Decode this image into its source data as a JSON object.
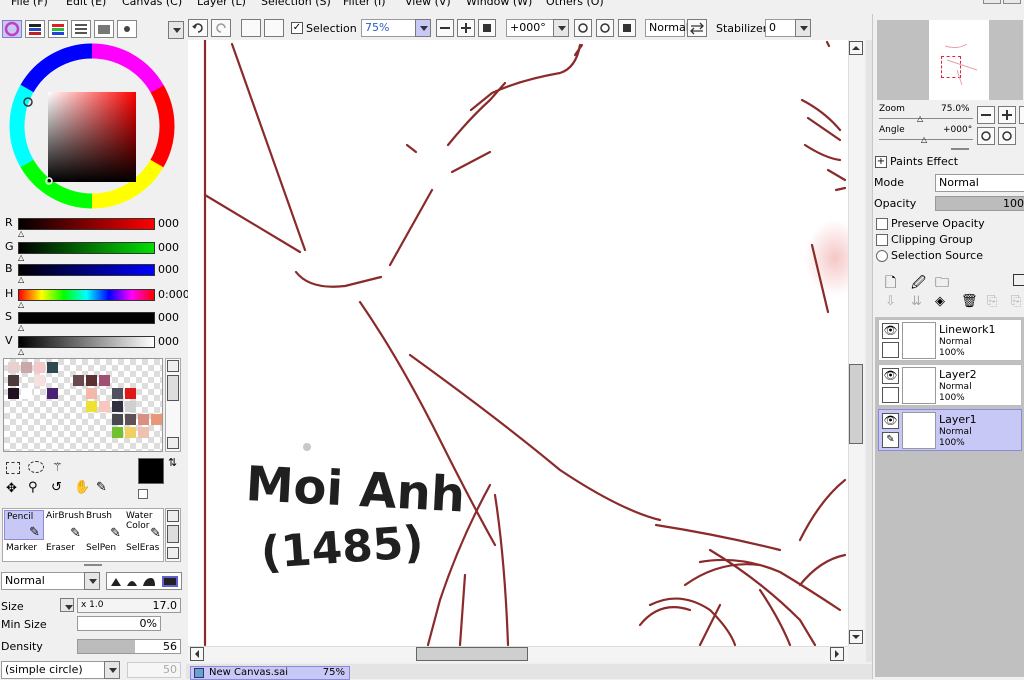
{
  "menu": [
    "File (F)",
    "Edit (E)",
    "Canvas (C)",
    "Layer (L)",
    "Selection (S)",
    "Filter (I)",
    "View (V)",
    "Window (W)",
    "Others (O)"
  ],
  "toolbar": {
    "selection_label": "Selection",
    "zoom_value": "75%",
    "angle_value": "+000°",
    "blend_mode": "Normal",
    "stabilizer_label": "Stabilizer",
    "stabilizer_value": "0"
  },
  "color": {
    "sliders": [
      {
        "label": "R",
        "value": "000"
      },
      {
        "label": "G",
        "value": "000"
      },
      {
        "label": "B",
        "value": "000"
      },
      {
        "label": "H",
        "value": "0:000"
      },
      {
        "label": "S",
        "value": "000"
      },
      {
        "label": "V",
        "value": "000"
      }
    ],
    "primary": "#000000",
    "secondary": "#ffffff"
  },
  "swatches": [
    {
      "c": "#e8d0d0",
      "r": 0,
      "col": 0
    },
    {
      "c": "#c8a8a8",
      "r": 0,
      "col": 1
    },
    {
      "c": "#f4c8c8",
      "r": 0,
      "col": 2
    },
    {
      "c": "#2e4a50",
      "r": 0,
      "col": 3
    },
    {
      "c": "#4a3a3a",
      "r": 1,
      "col": 0
    },
    {
      "c": "#f8e0e0",
      "r": 1,
      "col": 2
    },
    {
      "c": "#6a4850",
      "r": 1,
      "col": 5
    },
    {
      "c": "#5a3030",
      "r": 1,
      "col": 6
    },
    {
      "c": "#a05070",
      "r": 1,
      "col": 7
    },
    {
      "c": "#201020",
      "r": 2,
      "col": 0
    },
    {
      "c": "#ffffff",
      "r": 2,
      "col": 1
    },
    {
      "c": "#4a2070",
      "r": 2,
      "col": 3
    },
    {
      "c": "#f4b8a8",
      "r": 2,
      "col": 6
    },
    {
      "c": "#505060",
      "r": 2,
      "col": 8
    },
    {
      "c": "#e01818",
      "r": 2,
      "col": 9
    },
    {
      "c": "#f0e030",
      "r": 3,
      "col": 6
    },
    {
      "c": "#f8c8c0",
      "r": 3,
      "col": 7
    },
    {
      "c": "#303040",
      "r": 3,
      "col": 8
    },
    {
      "c": "#d0d0d0",
      "r": 3,
      "col": 9
    },
    {
      "c": "#484850",
      "r": 4,
      "col": 8
    },
    {
      "c": "#605058",
      "r": 4,
      "col": 9
    },
    {
      "c": "#d89080",
      "r": 4,
      "col": 10
    },
    {
      "c": "#e89878",
      "r": 4,
      "col": 11
    },
    {
      "c": "#70c030",
      "r": 5,
      "col": 8
    },
    {
      "c": "#f0d060",
      "r": 5,
      "col": 9
    },
    {
      "c": "#f0c0b0",
      "r": 5,
      "col": 10
    }
  ],
  "tools": [
    {
      "name": "Pencil",
      "sel": true
    },
    {
      "name": "AirBrush",
      "sel": false
    },
    {
      "name": "Brush",
      "sel": false
    },
    {
      "name": "Water Color",
      "sel": false
    },
    {
      "name": "Marker",
      "sel": false
    },
    {
      "name": "Eraser",
      "sel": false
    },
    {
      "name": "SelPen",
      "sel": false
    },
    {
      "name": "SelEras",
      "sel": false
    }
  ],
  "brush": {
    "mode": "Normal",
    "size_label": "Size",
    "size_mult": "x 1.0",
    "size_value": "17.0",
    "minsize_label": "Min Size",
    "minsize_value": "0%",
    "density_label": "Density",
    "density_value": "56",
    "shape": "(simple circle)",
    "shape_value": "50"
  },
  "navigator": {
    "zoom_label": "Zoom",
    "zoom_value": "75.0%",
    "angle_label": "Angle",
    "angle_value": "+000°"
  },
  "layer_props": {
    "paints_effect": "Paints Effect",
    "mode_label": "Mode",
    "mode_value": "Normal",
    "opacity_label": "Opacity",
    "opacity_value": "100",
    "preserve_opacity": "Preserve Opacity",
    "clipping_group": "Clipping Group",
    "selection_source": "Selection Source"
  },
  "layers": [
    {
      "name": "Linework1",
      "mode": "Normal",
      "opacity": "100%",
      "selected": false
    },
    {
      "name": "Layer2",
      "mode": "Normal",
      "opacity": "100%",
      "selected": false
    },
    {
      "name": "Layer1",
      "mode": "Normal",
      "opacity": "100%",
      "selected": true
    }
  ],
  "tab": {
    "title": "New Canvas.sai",
    "zoom": "75%"
  },
  "canvas_text": {
    "line1": "Moi Anh",
    "line2": "(1485)"
  },
  "colors": {
    "stroke": "#8b2a2a",
    "selection": "#c8c8f6"
  }
}
